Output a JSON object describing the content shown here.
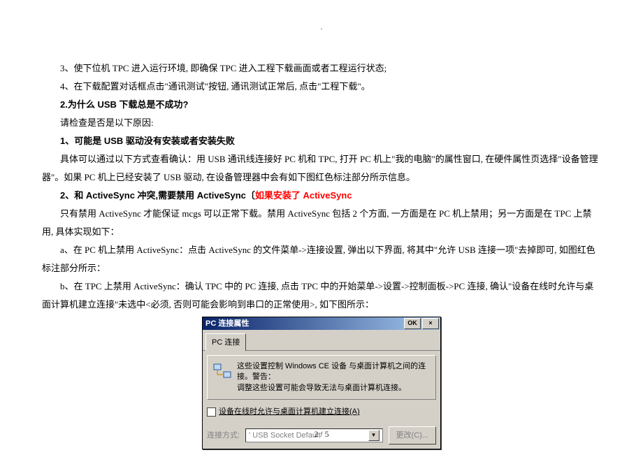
{
  "dot": ".",
  "lines": {
    "p1": "3、使下位机 TPC 进入运行环境, 即确保 TPC 进入工程下载画面或者工程运行状态;",
    "p2": "4、在下载配置对话框点击\"通讯测试\"按钮, 通讯测试正常后, 点击\"工程下载\"。",
    "q_heading": "2.为什么 USB 下载总是不成功?",
    "q_intro": "请检查是否是以下原因:",
    "r1": "1、可能是 USB 驱动没有安装或者安装失败",
    "r1_body": "具体可以通过以下方式查看确认：用 USB 通讯线连接好 PC 机和 TPC, 打开 PC 机上\"我的电脑\"的属性窗口, 在硬件属性页选择\"设备管理器\"。如果 PC 机上已经安装了 USB 驱动, 在设备管理器中会有如下图红色标注部分所示信息。",
    "r2_a": "2、和 ActiveSync 冲突,需要禁用 ActiveSync〔",
    "r2_b": "如果安装了 ActiveSync",
    "r2_body": "只有禁用 ActiveSync 才能保证 mcgs 可以正常下载。禁用 ActiveSync 包括 2 个方面, 一方面是在 PC 机上禁用；另一方面是在 TPC 上禁用, 具体实现如下：",
    "r2_a_step": "a、在 PC 机上禁用 ActiveSync：点击 ActiveSync 的文件菜单->连接设置, 弹出以下界面, 将其中\"允许 USB 连接一项\"去掉即可, 如图红色标注部分所示：",
    "r2_b_step": "b、在 TPC 上禁用 ActiveSync：确认 TPC 中的 PC 连接, 点击 TPC 中的开始菜单->设置->控制面板->PC 连接, 确认\"设备在线时允许与桌面计算机建立连接\"未选中<必须, 否则可能会影响到串口的正常使用>, 如下图所示："
  },
  "dialog": {
    "title": "PC 连接属性",
    "ok": "OK",
    "x": "×",
    "tab": "PC 连接",
    "body1": "这些设置控制 Windows CE 设备 与桌面计算机之间的连接。警告：",
    "body2": "调整这些设置可能会导致无法与桌面计算机连接。",
    "checkbox": "设备在线时允许与桌面计算机建立连接(A)",
    "conn_label": "连接方式:",
    "conn_value": "' USB Socket Default'",
    "change": "更改(C)..."
  },
  "page_footer": "2 / 5"
}
